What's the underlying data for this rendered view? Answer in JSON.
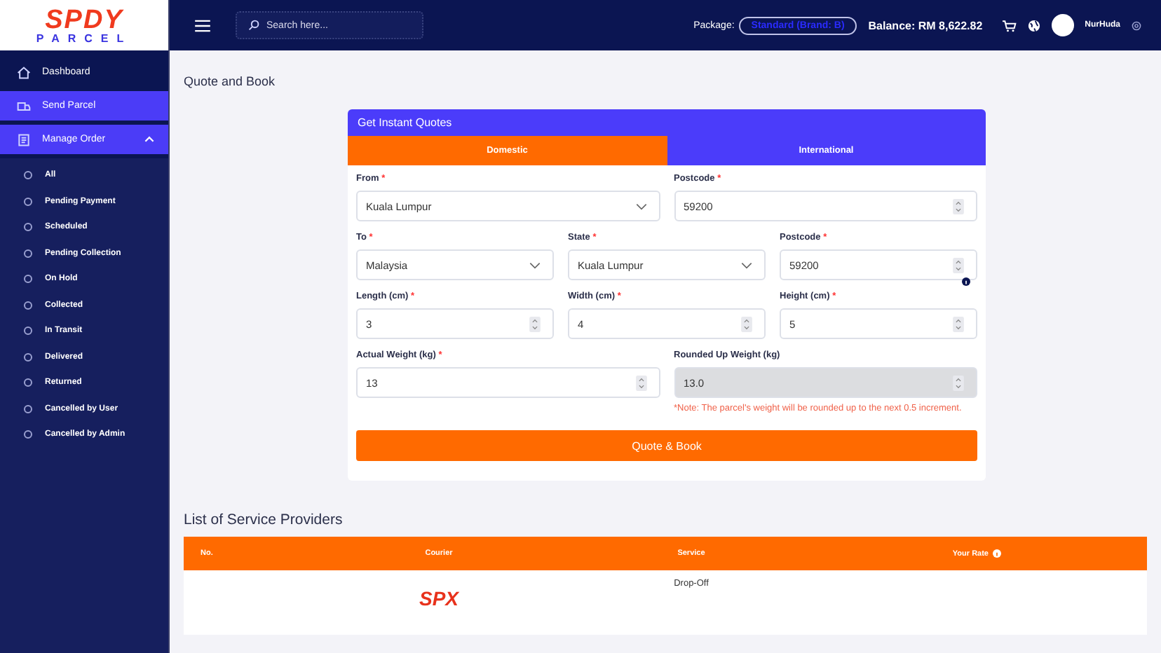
{
  "logo": {
    "title": "SPDY",
    "subtitle": "PARCEL"
  },
  "header": {
    "search_placeholder": "Search here...",
    "package_label": "Package:",
    "package_value": "Standard (Brand: B)",
    "balance": "Balance: RM 8,622.82",
    "user": "NurHuda"
  },
  "sidebar": {
    "items": [
      {
        "label": "Dashboard",
        "selected": false
      },
      {
        "label": "Send Parcel",
        "selected": true
      },
      {
        "label": "Manage Order",
        "selected": true,
        "expanded": true,
        "children": [
          {
            "label": "All"
          },
          {
            "label": "Pending Payment"
          },
          {
            "label": "Scheduled"
          },
          {
            "label": "Pending Collection"
          },
          {
            "label": "On Hold"
          },
          {
            "label": "Collected"
          },
          {
            "label": "In Transit"
          },
          {
            "label": "Delivered"
          },
          {
            "label": "Returned"
          },
          {
            "label": "Cancelled by User"
          },
          {
            "label": "Cancelled by Admin"
          }
        ]
      }
    ]
  },
  "page_title": "Quote and Book",
  "quote_card": {
    "title": "Get Instant Quotes",
    "tabs": [
      {
        "label": "Domestic",
        "selected": true
      },
      {
        "label": "International",
        "selected": false
      }
    ],
    "rows": [
      {
        "info": false,
        "fields": [
          {
            "label": "From",
            "required_mark": "*",
            "kind": "select",
            "value": "Kuala Lumpur",
            "disabled": false
          },
          {
            "label": "Postcode",
            "required_mark": "*",
            "kind": "number",
            "value": "59200",
            "disabled": false
          }
        ]
      },
      {
        "info": false,
        "fields": [
          {
            "label": "To",
            "required_mark": "*",
            "kind": "select",
            "value": "Malaysia",
            "disabled": false
          },
          {
            "label": "State",
            "required_mark": "*",
            "kind": "select",
            "value": "Kuala Lumpur",
            "disabled": false
          },
          {
            "label": "Postcode",
            "required_mark": "*",
            "kind": "number",
            "value": "59200",
            "disabled": false
          }
        ]
      },
      {
        "info": true,
        "fields": [
          {
            "label": "Length (cm)",
            "required_mark": "*",
            "kind": "number",
            "value": "3",
            "disabled": false
          },
          {
            "label": "Width (cm)",
            "required_mark": "*",
            "kind": "number",
            "value": "4",
            "disabled": false
          },
          {
            "label": "Height (cm)",
            "required_mark": "*",
            "kind": "number",
            "value": "5",
            "disabled": false
          }
        ]
      },
      {
        "info": false,
        "fields": [
          {
            "label": "Actual Weight (kg)",
            "required_mark": "*",
            "kind": "number",
            "value": "13",
            "disabled": false
          },
          {
            "label": "Rounded Up Weight (kg)",
            "kind": "number",
            "value": "13.0",
            "disabled": true,
            "note": "*Note: The parcel's weight will be rounded up to the next 0.5 increment."
          }
        ]
      }
    ],
    "button": "Quote & Book"
  },
  "providers": {
    "title": "List of Service Providers",
    "columns": [
      "No.",
      "Courier",
      "Service",
      "Your Rate"
    ],
    "rows": [
      {
        "courier": "SPX",
        "service": "Drop-Off"
      }
    ]
  }
}
